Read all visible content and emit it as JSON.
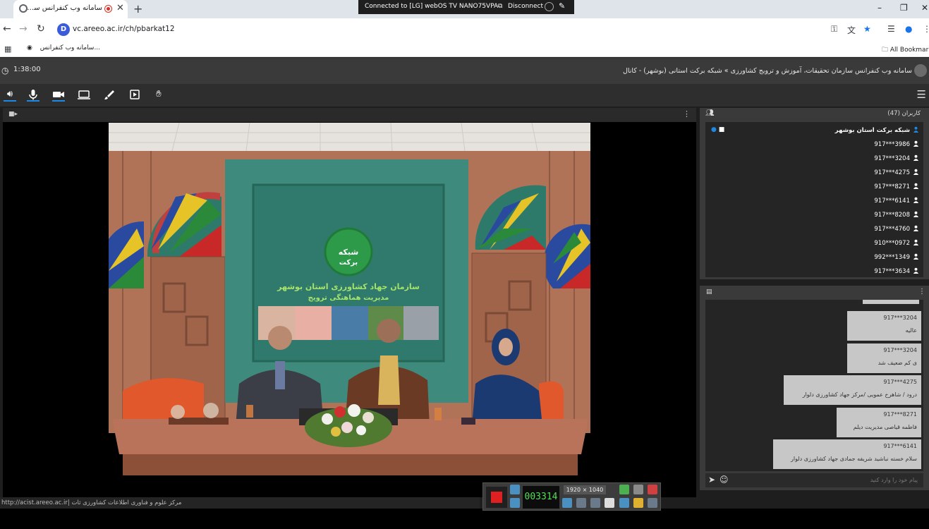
{
  "browser": {
    "tab_title": "سامانه وب کنفرانس سازمان ت",
    "cast_status": "Connected to [LG] webOS TV NANO75VPA",
    "cast_disconnect": "Disconnect",
    "url": "vc.areeo.ac.ir/ch/pbarkat12",
    "site_badge": "D",
    "bookmark_label": "سامانه وب کنفرانس...",
    "all_bookmarks": "All Bookmarks"
  },
  "app": {
    "elapsed_time": "1:38:00",
    "title": "سامانه وب کنفرانس سازمان تحقیقات، آموزش و ترویج کشاورزی » شبکه برکت استانی (بوشهر) - کانال"
  },
  "video": {
    "sign_logo_line1": "شبکه",
    "sign_logo_line2": "برکت",
    "sign_text_line1": "سازمان جهاد کشاورزی استان بوشهر",
    "sign_text_line2": "مدیریت هماهنگی ترویج"
  },
  "users": {
    "header": "کاربران (47)",
    "list": [
      {
        "name": "شبکه برکت استان بوشهر",
        "host": true
      },
      {
        "name": "917***3986"
      },
      {
        "name": "917***3204"
      },
      {
        "name": "917***4275"
      },
      {
        "name": "917***8271"
      },
      {
        "name": "917***6141"
      },
      {
        "name": "917***8208"
      },
      {
        "name": "917***4760"
      },
      {
        "name": "910***0972"
      },
      {
        "name": "992***1349"
      },
      {
        "name": "917***3634"
      }
    ]
  },
  "chat": {
    "messages": [
      {
        "user": "917***3204",
        "text": "عالیه"
      },
      {
        "user": "917***3204",
        "text": "ی کم ضعیف شد"
      },
      {
        "user": "917***4275",
        "text": "درود / شاهرخ عمویی /مرکز جهاد کشاورزی دلوار"
      },
      {
        "user": "917***8271",
        "text": "فاطمه قیاصی مدیریت دیلم"
      },
      {
        "user": "917***6141",
        "text": "سلام خسته نباشید شریفه جمادی جهاد کشاورزی دلوار"
      }
    ],
    "input_placeholder": "پیام خود را وارد کنید"
  },
  "status_text": "http://acist.areeo.ac.ir| مرکز علوم و فناوری اطلاعات کشاورزی ثات",
  "recorder": {
    "timer": "003314",
    "resolution": "1920 × 1040"
  },
  "colors": {
    "accent": "#1e88e5",
    "record_red": "#e02020",
    "panel_bg": "#3a3a3a"
  }
}
